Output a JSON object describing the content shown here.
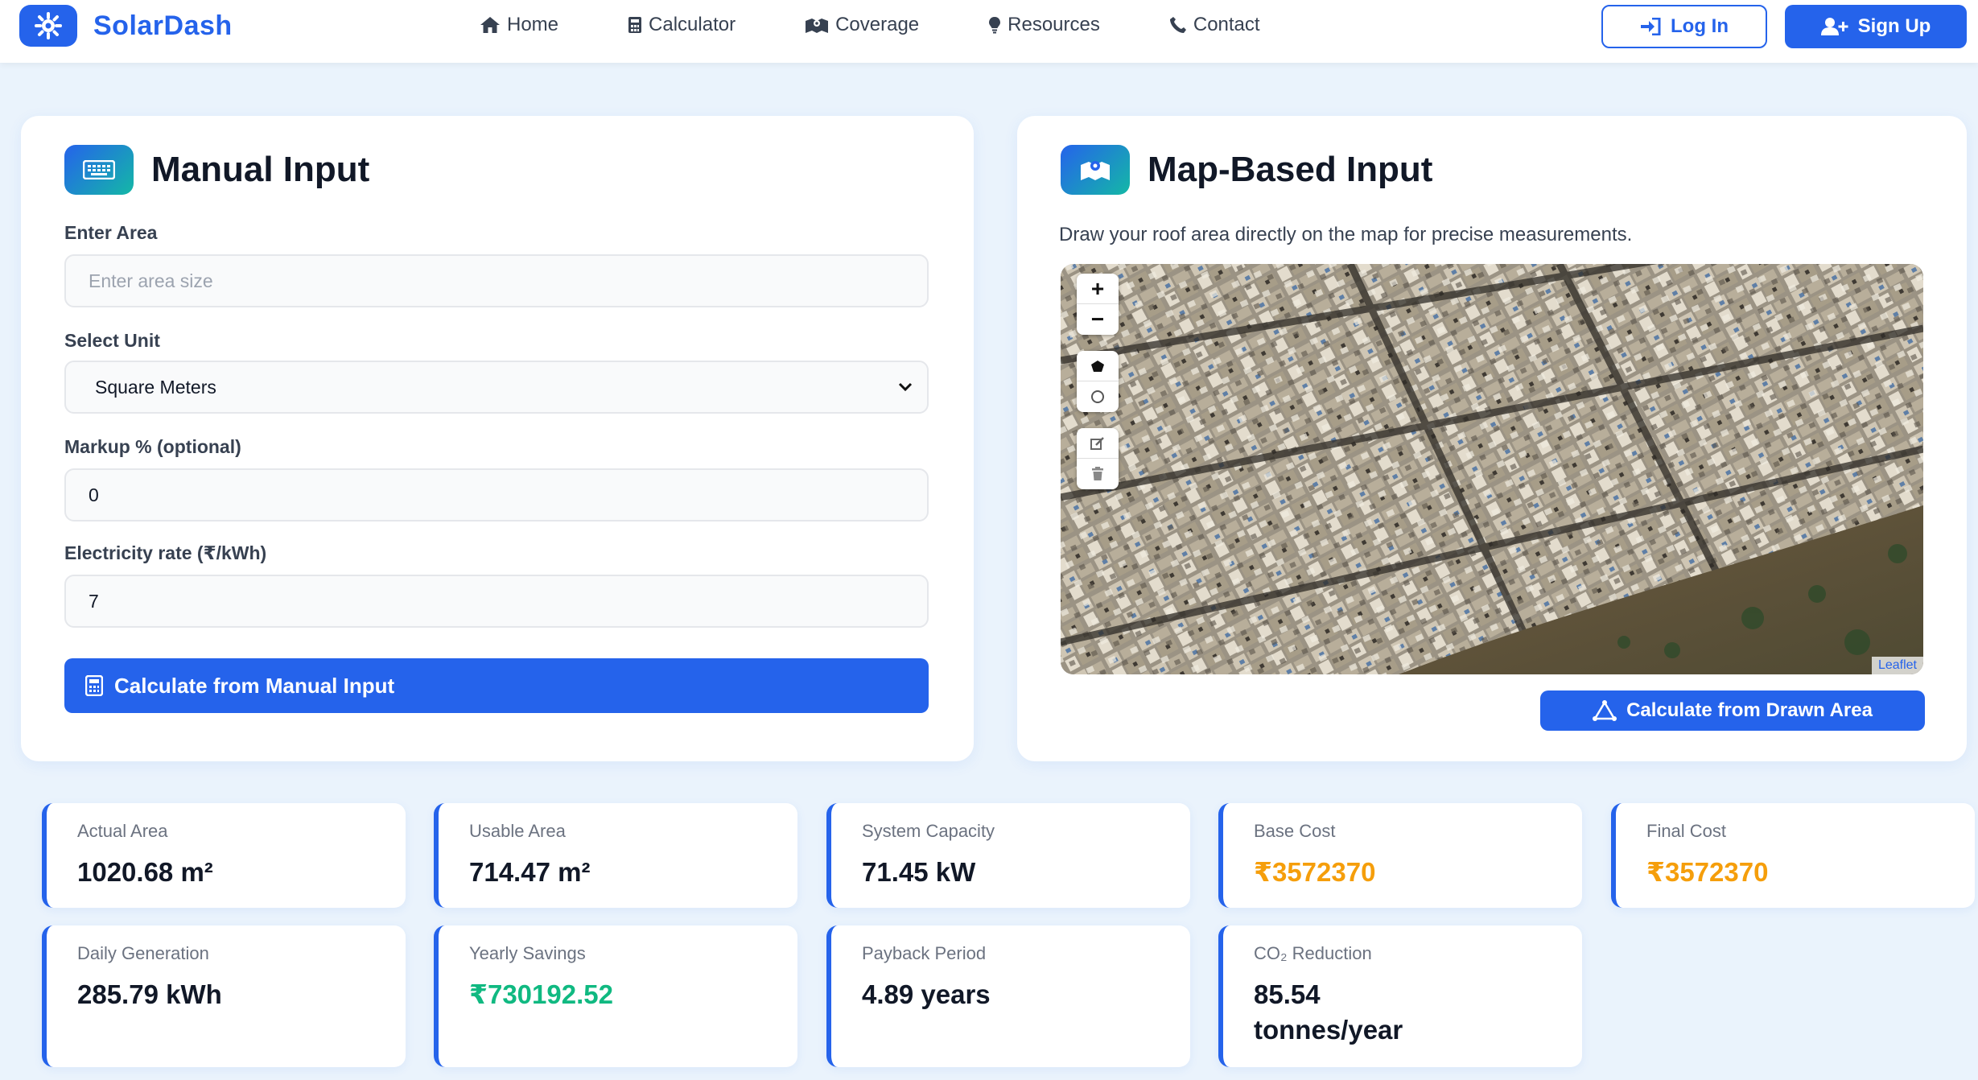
{
  "nav": {
    "brand": "SolarDash",
    "links": [
      {
        "label": "Home",
        "icon": "home-icon"
      },
      {
        "label": "Calculator",
        "icon": "calculator-icon"
      },
      {
        "label": "Coverage",
        "icon": "map-icon"
      },
      {
        "label": "Resources",
        "icon": "lightbulb-icon"
      },
      {
        "label": "Contact",
        "icon": "phone-icon"
      }
    ],
    "login": "Log In",
    "signup": "Sign Up"
  },
  "manual": {
    "title": "Manual Input",
    "area_label": "Enter Area",
    "area_placeholder": "Enter area size",
    "unit_label": "Select Unit",
    "unit_value": "Square Meters",
    "markup_label": "Markup % (optional)",
    "markup_value": "0",
    "rate_label": "Electricity rate (₹/kWh)",
    "rate_value": "7",
    "button": "Calculate from Manual Input"
  },
  "map": {
    "title": "Map-Based Input",
    "description": "Draw your roof area directly on the map for precise measurements.",
    "zoom_in": "+",
    "zoom_out": "−",
    "attribution": "Leaflet",
    "button": "Calculate from Drawn Area"
  },
  "stats": [
    {
      "label": "Actual Area",
      "value": "1020.68 m²"
    },
    {
      "label": "Usable Area",
      "value": "714.47 m²"
    },
    {
      "label": "System Capacity",
      "value": "71.45 kW"
    },
    {
      "label": "Base Cost",
      "value": "₹3572370"
    },
    {
      "label": "Final Cost",
      "value": "₹3572370"
    },
    {
      "label": "Daily Generation",
      "value": "285.79 kWh"
    },
    {
      "label": "Yearly Savings",
      "value": "₹730192.52"
    },
    {
      "label": "Payback Period",
      "value": "4.89 years"
    },
    {
      "label": "CO₂ Reduction",
      "value": "85.54 tonnes/year"
    }
  ],
  "colors": {
    "primary": "#2563eb",
    "accent_teal": "#14b8a6",
    "cost_orange": "#f59e0b",
    "savings_green": "#10b981",
    "page_bg": "#eaf3fc"
  }
}
